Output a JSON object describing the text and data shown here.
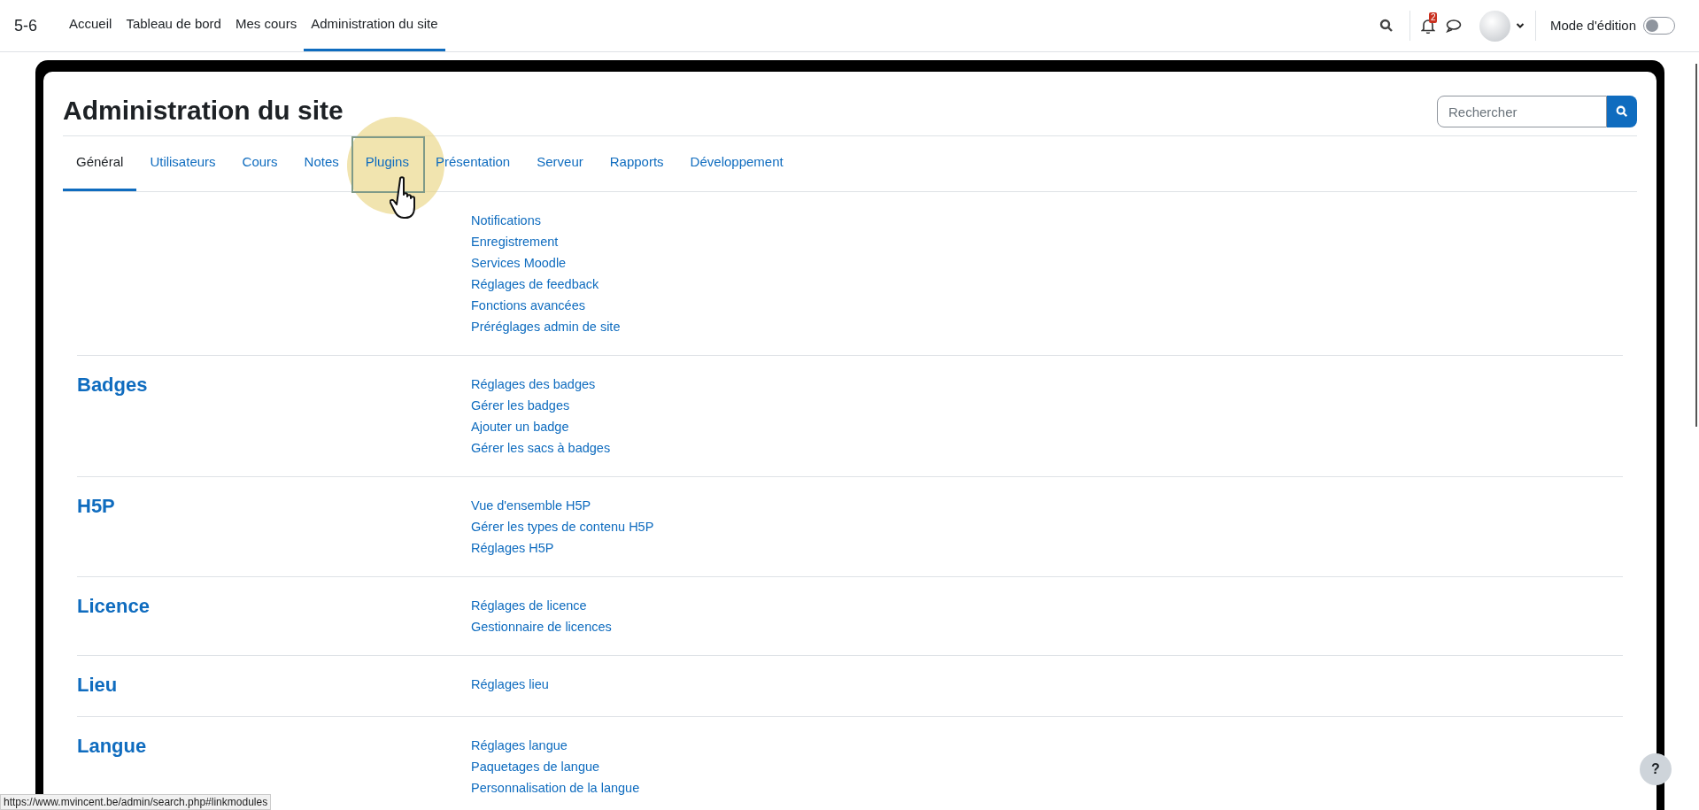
{
  "top_nav": {
    "brand": "5-6",
    "items": [
      {
        "label": "Accueil",
        "selected": false
      },
      {
        "label": "Tableau de bord",
        "selected": false
      },
      {
        "label": "Mes cours",
        "selected": false
      },
      {
        "label": "Administration du site",
        "selected": true
      }
    ],
    "notification_count": "2",
    "edit_mode": {
      "label": "Mode d'édition",
      "on": false
    }
  },
  "page": {
    "title": "Administration du site",
    "search": {
      "placeholder": "Rechercher"
    },
    "tabs": [
      {
        "label": "Général",
        "selected": true
      },
      {
        "label": "Utilisateurs",
        "selected": false
      },
      {
        "label": "Cours",
        "selected": false
      },
      {
        "label": "Notes",
        "selected": false
      },
      {
        "label": "Plugins",
        "selected": false
      },
      {
        "label": "Présentation",
        "selected": false
      },
      {
        "label": "Serveur",
        "selected": false
      },
      {
        "label": "Rapports",
        "selected": false
      },
      {
        "label": "Développement",
        "selected": false
      }
    ],
    "sections": [
      {
        "links": [
          "Notifications",
          "Enregistrement",
          "Services Moodle",
          "Réglages de feedback",
          "Fonctions avancées",
          "Préréglages admin de site"
        ]
      },
      {
        "heading": "Badges",
        "links": [
          "Réglages des badges",
          "Gérer les badges",
          "Ajouter un badge",
          "Gérer les sacs à badges"
        ]
      },
      {
        "heading": "H5P",
        "links": [
          "Vue d'ensemble H5P",
          "Gérer les types de contenu H5P",
          "Réglages H5P"
        ]
      },
      {
        "heading": "Licence",
        "links": [
          "Réglages de licence",
          "Gestionnaire de licences"
        ]
      },
      {
        "heading": "Lieu",
        "links": [
          "Réglages lieu"
        ]
      },
      {
        "heading": "Langue",
        "links": [
          "Réglages langue",
          "Paquetages de langue",
          "Personnalisation de la langue"
        ]
      }
    ]
  },
  "status_url": "https://www.mvincent.be/admin/search.php#linkmodules",
  "help_button": "?"
}
